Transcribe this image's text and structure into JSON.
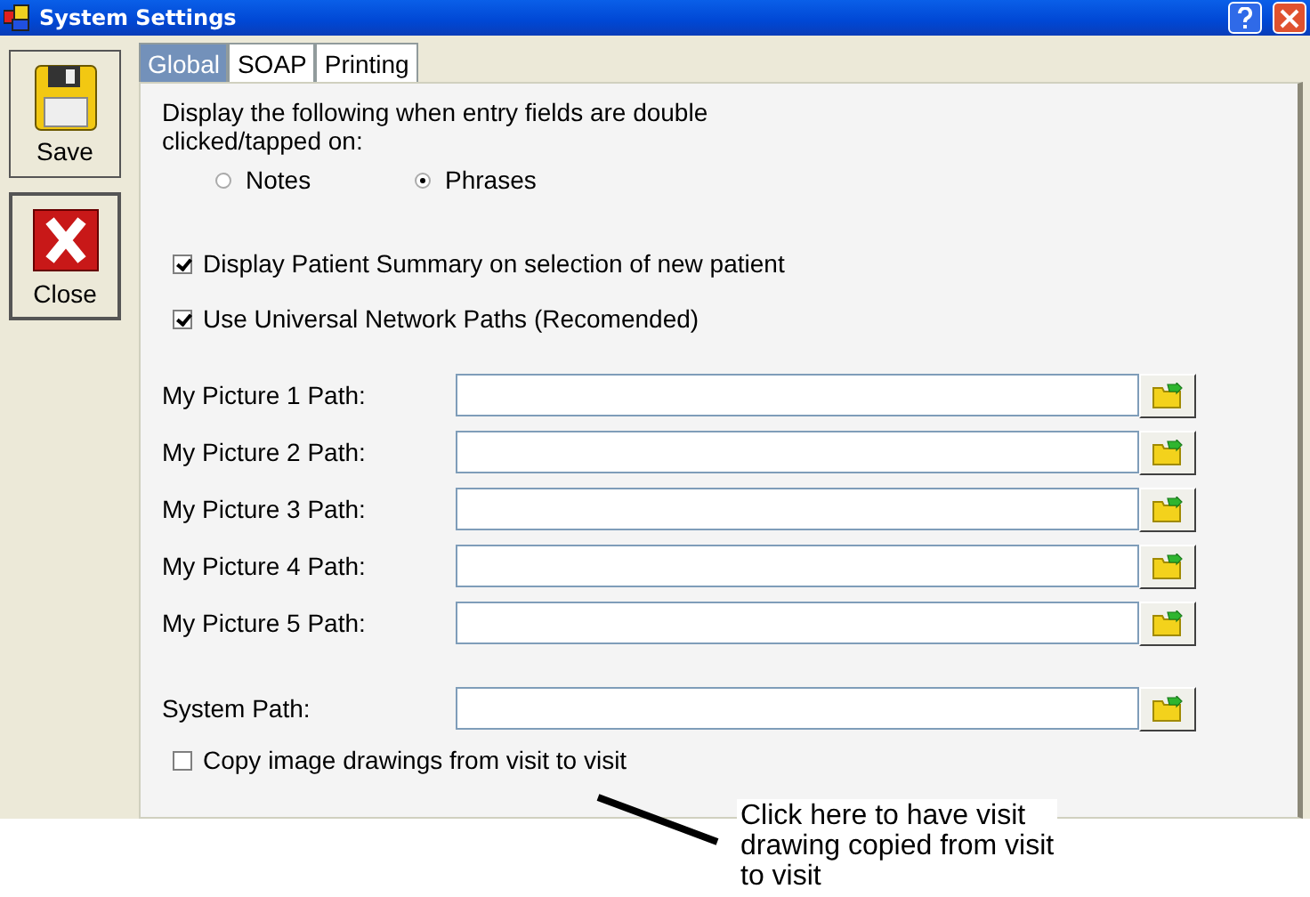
{
  "window": {
    "title": "System Settings"
  },
  "sidebar_buttons": [
    {
      "label": "Save",
      "kind": "save"
    },
    {
      "label": "Close",
      "kind": "close"
    }
  ],
  "tabs": [
    {
      "label": "Global",
      "selected": true
    },
    {
      "label": "SOAP",
      "selected": false
    },
    {
      "label": "Printing",
      "selected": false
    }
  ],
  "double_click_prompt": "Display the following when entry fields are double clicked/tapped on:",
  "double_click_options": [
    {
      "label": "Notes",
      "selected": false
    },
    {
      "label": "Phrases",
      "selected": true
    }
  ],
  "options": [
    {
      "label": "Display Patient Summary on selection of new patient",
      "checked": true
    },
    {
      "label": "Use Universal Network Paths (Recomended)",
      "checked": true
    }
  ],
  "paths": [
    {
      "label": "My Picture 1 Path:"
    },
    {
      "label": "My Picture 2 Path:"
    },
    {
      "label": "My Picture 3 Path:"
    },
    {
      "label": "My Picture 4 Path:"
    },
    {
      "label": "My Picture 5 Path:"
    }
  ],
  "system_path": {
    "label": "System Path:"
  },
  "copy_drawings": {
    "label": "Copy image drawings from visit to visit",
    "checked": false
  },
  "annotation": "Click here to have visit drawing copied from visit to visit"
}
